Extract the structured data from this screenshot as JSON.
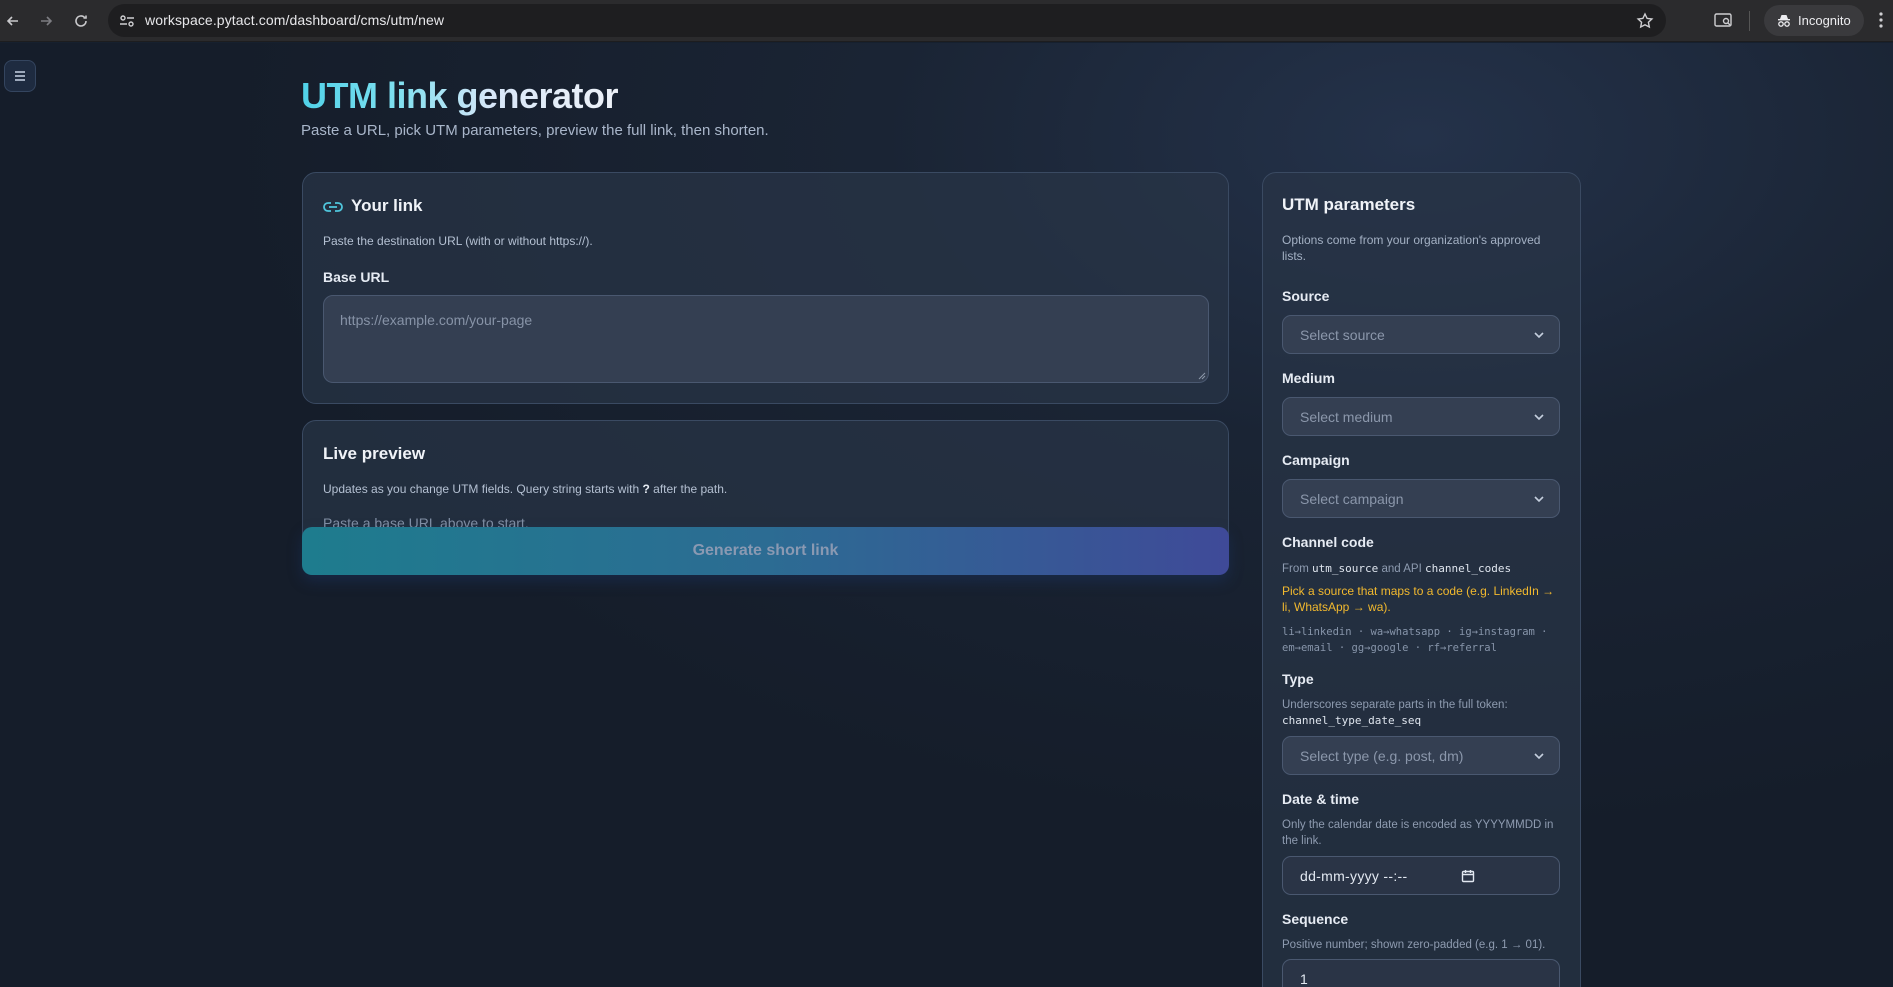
{
  "browser": {
    "url": "workspace.pytact.com/dashboard/cms/utm/new",
    "incognito_label": "Incognito"
  },
  "header": {
    "title": "UTM link generator",
    "subtitle": "Paste a URL, pick UTM parameters, preview the full link, then shorten."
  },
  "your_link": {
    "title": "Your link",
    "description": "Paste the destination URL (with or without https://).",
    "base_url_label": "Base URL",
    "base_url_placeholder": "https://example.com/your-page",
    "base_url_value": ""
  },
  "live_preview": {
    "title": "Live preview",
    "description_prefix": "Updates as you change UTM fields. Query string starts with ",
    "description_token": "?",
    "description_suffix": " after the path.",
    "empty_text": "Paste a base URL above to start."
  },
  "generate_button": "Generate short link",
  "utm": {
    "title": "UTM parameters",
    "description": "Options come from your organization's approved lists.",
    "source": {
      "label": "Source",
      "placeholder": "Select source"
    },
    "medium": {
      "label": "Medium",
      "placeholder": "Select medium"
    },
    "campaign": {
      "label": "Campaign",
      "placeholder": "Select campaign"
    },
    "channel_code": {
      "label": "Channel code",
      "help_from": "From",
      "help_code1": "utm_source",
      "help_and": "and API",
      "help_code2": "channel_codes",
      "warning": "Pick a source that maps to a code (e.g. LinkedIn → li, WhatsApp → wa).",
      "codes_line1": "li→linkedin · wa→whatsapp · ig→instagram ·",
      "codes_line2": "em→email · gg→google · rf→referral"
    },
    "type": {
      "label": "Type",
      "help": "Underscores separate parts in the full token:",
      "help_code": "channel_type_date_seq",
      "placeholder": "Select type (e.g. post, dm)"
    },
    "date_time": {
      "label": "Date & time",
      "help": "Only the calendar date is encoded as YYYYMMDD in the link.",
      "value": "dd-mm-yyyy --:--"
    },
    "sequence": {
      "label": "Sequence",
      "help": "Positive number; shown zero-padded (e.g. 1 → 01).",
      "value": "1"
    }
  }
}
